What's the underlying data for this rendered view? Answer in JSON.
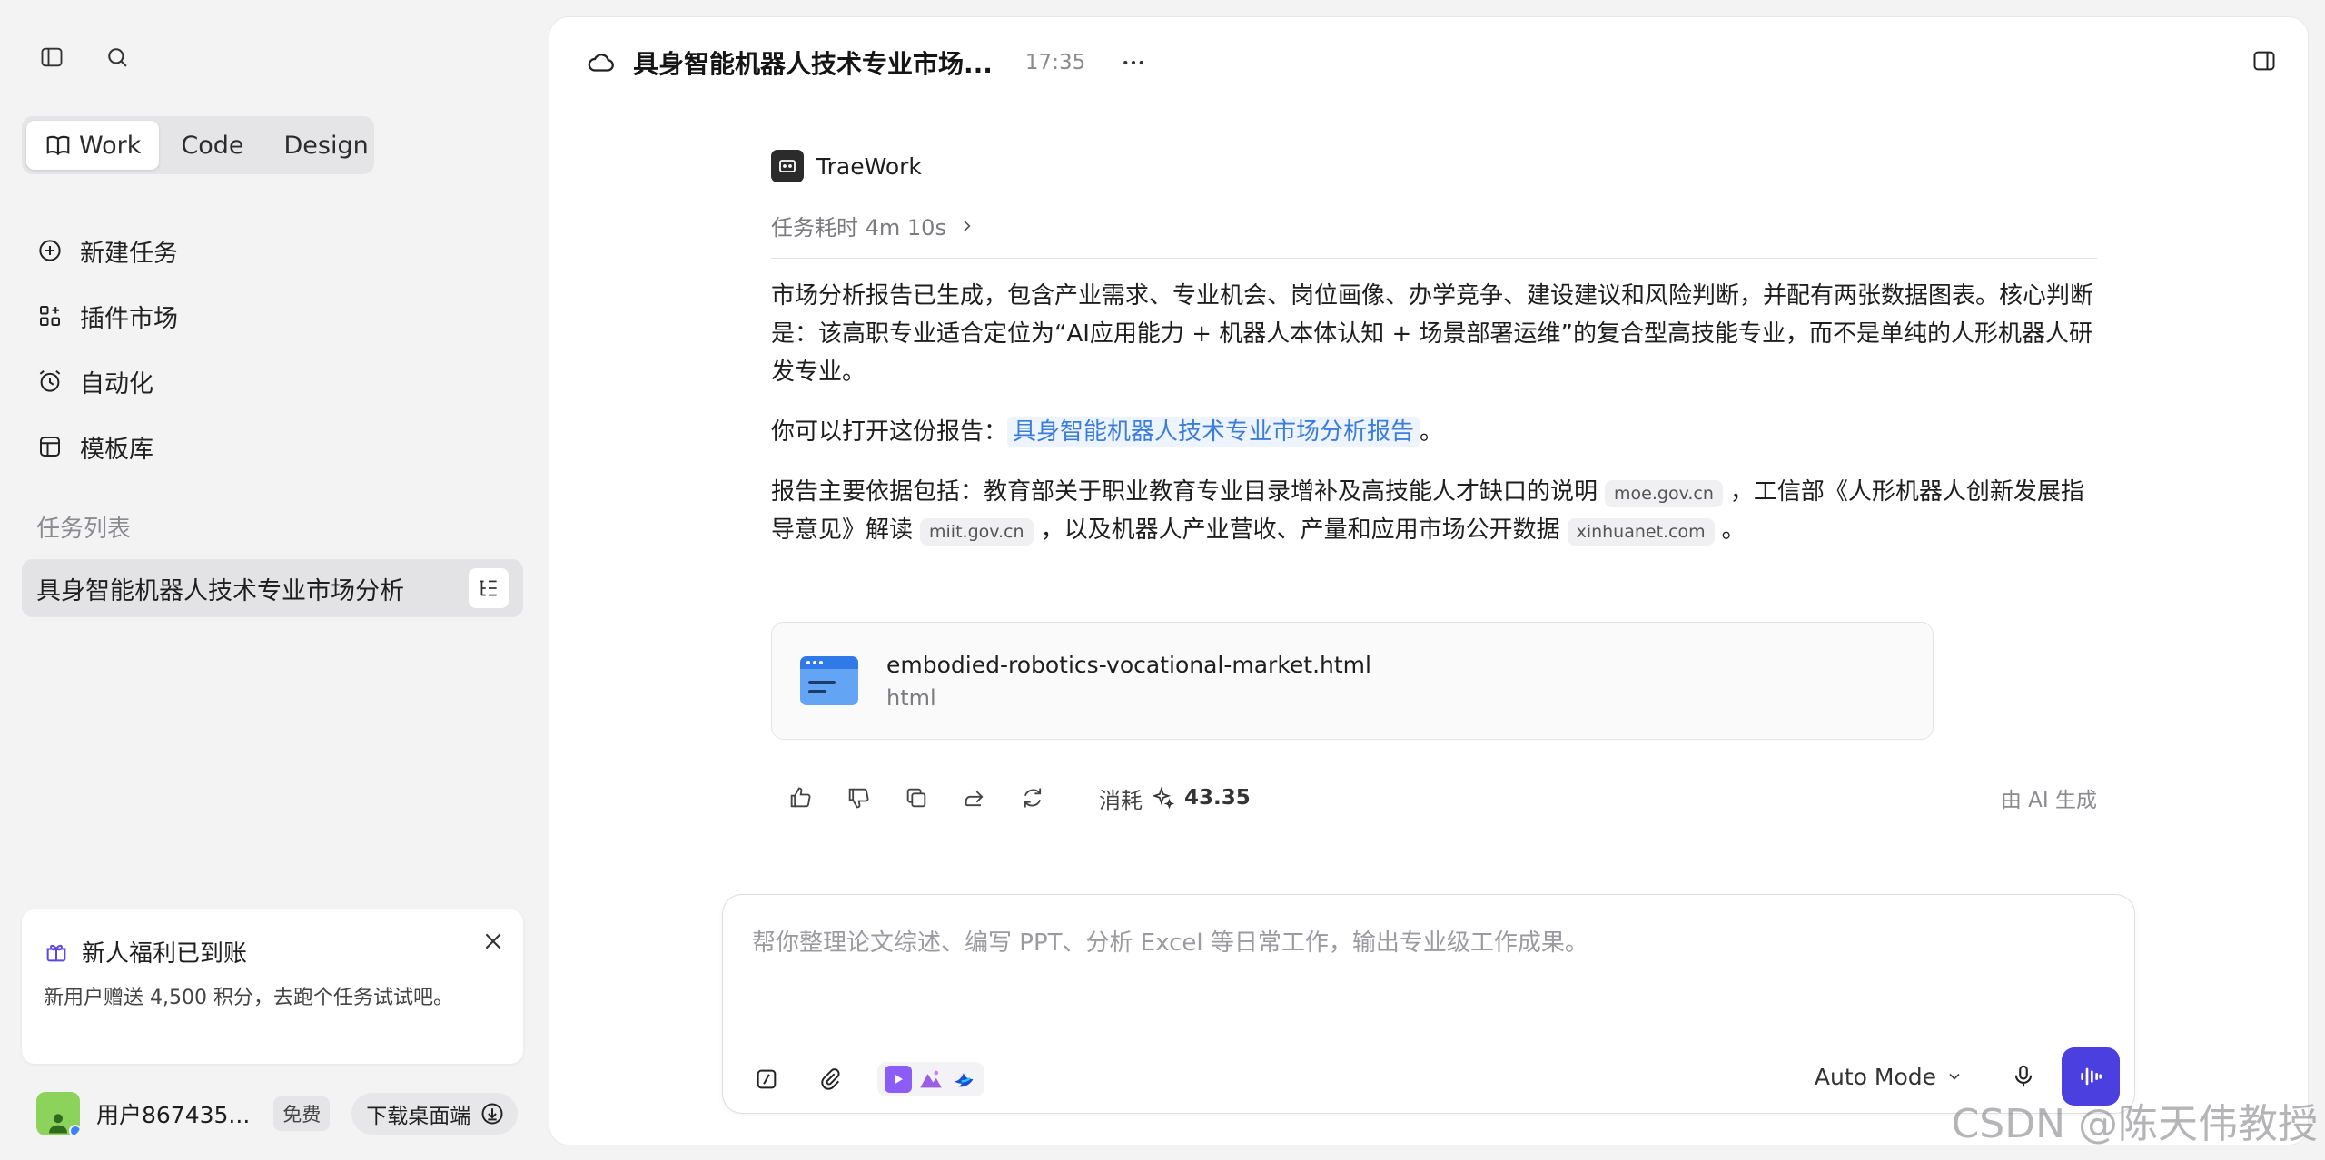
{
  "sidebar": {
    "modes": [
      {
        "label": "Work",
        "active": true,
        "icon": "book-icon"
      },
      {
        "label": "Code",
        "active": false
      },
      {
        "label": "Design",
        "active": false
      }
    ],
    "nav": [
      {
        "label": "新建任务",
        "icon": "plus-circle-icon"
      },
      {
        "label": "插件市场",
        "icon": "plugin-icon"
      },
      {
        "label": "自动化",
        "icon": "alarm-clock-icon"
      },
      {
        "label": "模板库",
        "icon": "template-icon"
      }
    ],
    "task_list_title": "任务列表",
    "task_item": "具身智能机器人技术专业市场分析",
    "promo": {
      "title": "新人福利已到账",
      "body": "新用户赠送 4,500 积分，去跑个任务试试吧。"
    },
    "user": {
      "name": "用户867435...",
      "plan": "免费",
      "download": "下载桌面端"
    }
  },
  "header": {
    "title": "具身智能机器人技术专业市场...",
    "time": "17:35"
  },
  "message": {
    "brand": "TraeWork",
    "duration": "任务耗时 4m 10s",
    "para1": "市场分析报告已生成，包含产业需求、专业机会、岗位画像、办学竞争、建设建议和风险判断，并配有两张数据图表。核心判断是：该高职专业适合定位为“AI应用能力 + 机器人本体认知 + 场景部署运维”的复合型高技能专业，而不是单纯的人形机器人研发专业。",
    "para2_prefix": "你可以打开这份报告：",
    "para2_link": "具身智能机器人技术专业市场分析报告",
    "para2_suffix": "。",
    "para3_a": "报告主要依据包括：教育部关于职业教育专业目录增补及高技能人才缺口的说明",
    "src1": "moe.gov.cn",
    "para3_b": "，工信部《人形机器人创新发展指导意见》解读",
    "src2": "miit.gov.cn",
    "para3_c": "，以及机器人产业营收、产量和应用市场公开数据",
    "src3": "xinhuanet.com",
    "para3_d": "。"
  },
  "file": {
    "name": "embodied-robotics-vocational-market.html",
    "type": "html"
  },
  "actions": {
    "consume_label": "消耗",
    "consume_value": "43.35",
    "ai_generated": "由 AI 生成"
  },
  "composer": {
    "placeholder": "帮你整理论文综述、编写 PPT、分析 Excel 等日常工作，输出专业级工作成果。",
    "mode": "Auto Mode"
  },
  "watermark": "CSDN @陈天伟教授",
  "colors": {
    "accent": "#4b3fe0",
    "link": "#3b7ddd"
  }
}
